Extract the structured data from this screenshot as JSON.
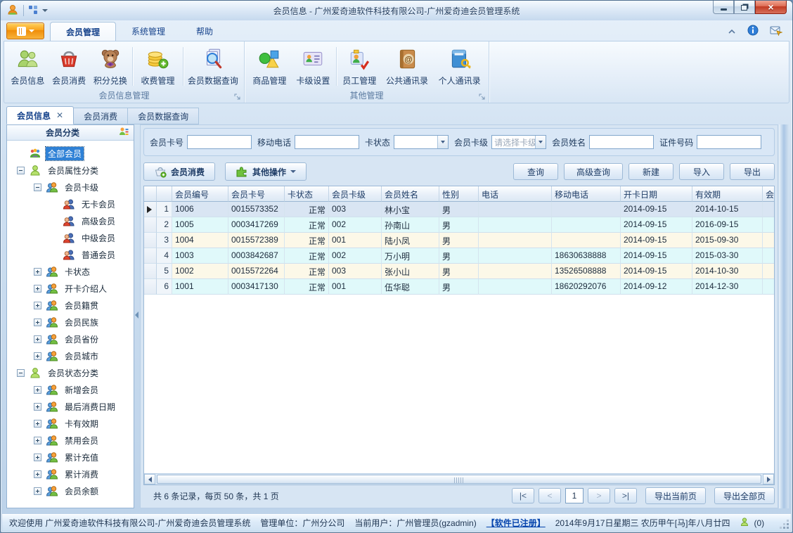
{
  "window": {
    "title": "会员信息 - 广州爱奇迪软件科技有限公司-广州爱奇迪会员管理系统",
    "controls": [
      "minimize",
      "restore",
      "close"
    ]
  },
  "titlebar_icons": [
    "app-icon",
    "layout-grid-icon",
    "dropdown-caret-icon"
  ],
  "ribbon": {
    "tabs": [
      {
        "label": "会员管理",
        "active": true
      },
      {
        "label": "系统管理",
        "active": false
      },
      {
        "label": "帮助",
        "active": false
      }
    ],
    "right_icons": [
      "collapse-ribbon-icon",
      "info-icon",
      "mail-icon"
    ],
    "groups": [
      {
        "label": "会员信息管理",
        "buttons": [
          {
            "label": "会员信息",
            "icon": "members-icon"
          },
          {
            "label": "会员消费",
            "icon": "basket-icon"
          },
          {
            "label": "积分兑换",
            "icon": "teddy-bear-icon"
          },
          {
            "label": "收费管理",
            "icon": "coins-icon"
          },
          {
            "label": "会员数据查询",
            "icon": "member-search-icon"
          }
        ]
      },
      {
        "label": "其他管理",
        "buttons": [
          {
            "label": "商品管理",
            "icon": "goods-icon"
          },
          {
            "label": "卡级设置",
            "icon": "card-level-icon"
          },
          {
            "label": "员工管理",
            "icon": "staff-icon"
          },
          {
            "label": "公共通讯录",
            "icon": "public-contacts-icon"
          },
          {
            "label": "个人通讯录",
            "icon": "personal-contacts-icon"
          }
        ]
      }
    ]
  },
  "doc_tabs": [
    {
      "label": "会员信息",
      "active": true,
      "closable": true
    },
    {
      "label": "会员消费",
      "active": false
    },
    {
      "label": "会员数据查询",
      "active": false
    }
  ],
  "sidebar": {
    "header": "会员分类",
    "header_icon": "member-settings-icon",
    "tree": [
      {
        "label": "全部会员",
        "depth": 0,
        "icon": "all-members-icon",
        "toggle": null,
        "selected": true
      },
      {
        "label": "会员属性分类",
        "depth": 0,
        "icon": "green-member-icon",
        "toggle": "minus"
      },
      {
        "label": "会员卡级",
        "depth": 1,
        "icon": "orange-members-icon",
        "toggle": "minus"
      },
      {
        "label": "无卡会员",
        "depth": 2,
        "icon": "member-pair-icon",
        "toggle": null
      },
      {
        "label": "高级会员",
        "depth": 2,
        "icon": "member-pair-icon",
        "toggle": null
      },
      {
        "label": "中级会员",
        "depth": 2,
        "icon": "member-pair-icon",
        "toggle": null
      },
      {
        "label": "普通会员",
        "depth": 2,
        "icon": "member-pair-icon",
        "toggle": null
      },
      {
        "label": "卡状态",
        "depth": 1,
        "icon": "orange-members-icon",
        "toggle": "plus"
      },
      {
        "label": "开卡介绍人",
        "depth": 1,
        "icon": "orange-members-icon",
        "toggle": "plus"
      },
      {
        "label": "会员籍贯",
        "depth": 1,
        "icon": "orange-members-icon",
        "toggle": "plus"
      },
      {
        "label": "会员民族",
        "depth": 1,
        "icon": "orange-members-icon",
        "toggle": "plus"
      },
      {
        "label": "会员省份",
        "depth": 1,
        "icon": "orange-members-icon",
        "toggle": "plus"
      },
      {
        "label": "会员城市",
        "depth": 1,
        "icon": "orange-members-icon",
        "toggle": "plus"
      },
      {
        "label": "会员状态分类",
        "depth": 0,
        "icon": "green-member-icon",
        "toggle": "minus"
      },
      {
        "label": "新增会员",
        "depth": 1,
        "icon": "orange-members-icon",
        "toggle": "plus"
      },
      {
        "label": "最后消费日期",
        "depth": 1,
        "icon": "orange-members-icon",
        "toggle": "plus"
      },
      {
        "label": "卡有效期",
        "depth": 1,
        "icon": "orange-members-icon",
        "toggle": "plus"
      },
      {
        "label": "禁用会员",
        "depth": 1,
        "icon": "orange-members-icon",
        "toggle": "plus"
      },
      {
        "label": "累计充值",
        "depth": 1,
        "icon": "orange-members-icon",
        "toggle": "plus"
      },
      {
        "label": "累计消费",
        "depth": 1,
        "icon": "orange-members-icon",
        "toggle": "plus"
      },
      {
        "label": "会员余额",
        "depth": 1,
        "icon": "orange-members-icon",
        "toggle": "plus"
      }
    ]
  },
  "search": {
    "fields": [
      {
        "label": "会员卡号",
        "type": "input",
        "value": "",
        "name": "card-no-input"
      },
      {
        "label": "移动电话",
        "type": "input",
        "value": "",
        "name": "mobile-input"
      },
      {
        "label": "卡状态",
        "type": "select",
        "value": "",
        "name": "card-status-select"
      },
      {
        "label": "会员卡级",
        "type": "select",
        "value": "请选择卡级",
        "name": "card-level-select"
      },
      {
        "label": "会员姓名",
        "type": "input",
        "value": "",
        "name": "member-name-input"
      },
      {
        "label": "证件号码",
        "type": "input",
        "value": "",
        "name": "id-number-input"
      }
    ]
  },
  "toolbar": {
    "consume_label": "会员消费",
    "other_label": "其他操作",
    "right_buttons": [
      "查询",
      "高级查询",
      "新建",
      "导入",
      "导出"
    ]
  },
  "grid": {
    "columns": [
      "会员编号",
      "会员卡号",
      "卡状态",
      "会员卡级",
      "会员姓名",
      "性别",
      "电话",
      "移动电话",
      "开卡日期",
      "有效期",
      "会员"
    ],
    "selected_row": 0,
    "rows": [
      {
        "num": "1",
        "cells": [
          "1006",
          "0015573352",
          "正常",
          "003",
          "林小宝",
          "男",
          "",
          "",
          "2014-09-15",
          "2014-10-15",
          ""
        ]
      },
      {
        "num": "2",
        "cells": [
          "1005",
          "0003417269",
          "正常",
          "002",
          "孙南山",
          "男",
          "",
          "",
          "2014-09-15",
          "2016-09-15",
          ""
        ]
      },
      {
        "num": "3",
        "cells": [
          "1004",
          "0015572389",
          "正常",
          "001",
          "陆小凤",
          "男",
          "",
          "",
          "2014-09-15",
          "2015-09-30",
          ""
        ]
      },
      {
        "num": "4",
        "cells": [
          "1003",
          "0003842687",
          "正常",
          "002",
          "万小明",
          "男",
          "",
          "18630638888",
          "2014-09-15",
          "2015-03-30",
          ""
        ]
      },
      {
        "num": "5",
        "cells": [
          "1002",
          "0015572264",
          "正常",
          "003",
          "张小山",
          "男",
          "",
          "13526508888",
          "2014-09-15",
          "2014-10-30",
          ""
        ]
      },
      {
        "num": "6",
        "cells": [
          "1001",
          "0003417130",
          "正常",
          "001",
          "伍华聪",
          "男",
          "",
          "18620292076",
          "2014-09-12",
          "2014-12-30",
          ""
        ]
      }
    ]
  },
  "pager": {
    "summary": "共 6 条记录，每页 50 条，共 1 页",
    "first": "|<",
    "prev": "<",
    "page_value": "1",
    "next": ">",
    "last": ">|",
    "export_current": "导出当前页",
    "export_all": "导出全部页"
  },
  "statusbar": {
    "welcome": "欢迎使用 广州爱奇迪软件科技有限公司-广州爱奇迪会员管理系统",
    "org": "管理单位：广州分公司",
    "user": "当前用户：广州管理员(gzadmin)",
    "license": "【软件已注册】",
    "datetime": "2014年9月17日星期三 农历甲午[马]年八月廿四",
    "count": "(0)"
  }
}
